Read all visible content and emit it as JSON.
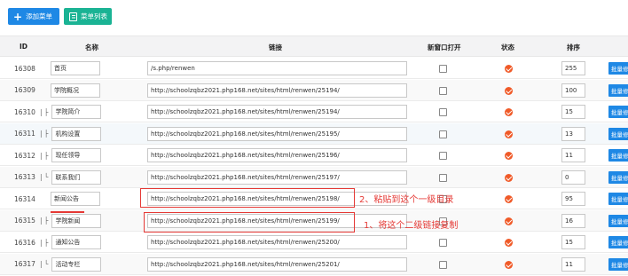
{
  "toolbar": {
    "add_label": "添加菜单",
    "list_label": "菜单列表"
  },
  "header": {
    "id": "ID",
    "name": "名称",
    "link": "链接",
    "new_window": "新窗口打开",
    "status": "状态",
    "sort": "排序"
  },
  "rows": [
    {
      "id": "16308",
      "tree": "",
      "name": "首页",
      "link": "/s.php/renwen",
      "sort": "255",
      "op": "批量修改"
    },
    {
      "id": "16309",
      "tree": "",
      "name": "学院概况",
      "link": "http://schoolzqbz2021.php168.net/sites/html/renwen/25194/",
      "sort": "100",
      "op": "批量修改"
    },
    {
      "id": "16310",
      "tree": "| ├",
      "name": "学院简介",
      "link": "http://schoolzqbz2021.php168.net/sites/html/renwen/25194/",
      "sort": "15",
      "op": "批量修改"
    },
    {
      "id": "16311",
      "tree": "| ├",
      "name": "机构设置",
      "link": "http://schoolzqbz2021.php168.net/sites/html/renwen/25195/",
      "sort": "13",
      "op": "批量修改"
    },
    {
      "id": "16312",
      "tree": "| ├",
      "name": "现任领导",
      "link": "http://schoolzqbz2021.php168.net/sites/html/renwen/25196/",
      "sort": "11",
      "op": "批量修改"
    },
    {
      "id": "16313",
      "tree": "| └",
      "name": "联系我们",
      "link": "http://schoolzqbz2021.php168.net/sites/html/renwen/25197/",
      "sort": "0",
      "op": "批量修改"
    },
    {
      "id": "16314",
      "tree": "",
      "name": "新闻公告",
      "link": "http://schoolzqbz2021.php168.net/sites/html/renwen/25198/",
      "sort": "95",
      "op": "批量修改"
    },
    {
      "id": "16315",
      "tree": "| ├",
      "name": "学院新闻",
      "link": "http://schoolzqbz2021.php168.net/sites/html/renwen/25199/",
      "sort": "16",
      "op": "批量修改"
    },
    {
      "id": "16316",
      "tree": "| ├",
      "name": "通知公告",
      "link": "http://schoolzqbz2021.php168.net/sites/html/renwen/25200/",
      "sort": "15",
      "op": "批量修改"
    },
    {
      "id": "16317",
      "tree": "| └",
      "name": "活动专栏",
      "link": "http://schoolzqbz2021.php168.net/sites/html/renwen/25201/",
      "sort": "11",
      "op": "批量修改"
    }
  ],
  "annotations": {
    "step2": "2、粘贴到这个一级目录",
    "step1": "1、将这个二级链接复制"
  },
  "colors": {
    "primary": "#1e88e5",
    "success": "#1ab394",
    "status": "#f05a28",
    "annotation": "#e53935"
  }
}
